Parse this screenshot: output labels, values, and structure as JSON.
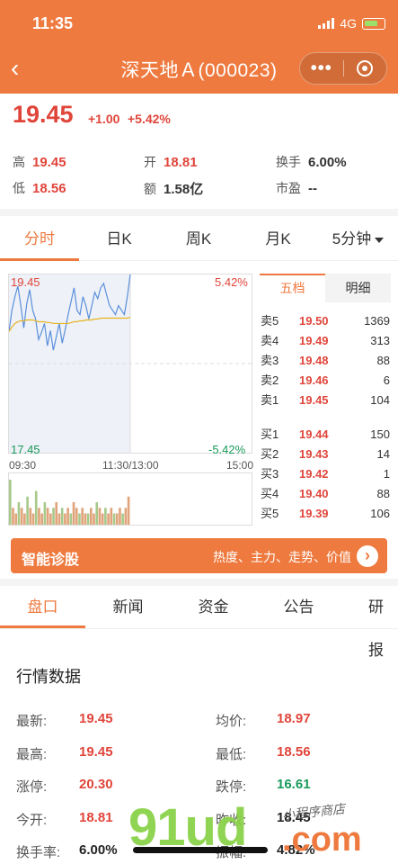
{
  "status": {
    "time": "11:35",
    "network": "4G"
  },
  "header": {
    "back_icon": "chevron-left-icon",
    "title": "深天地Ａ(000023)",
    "more_icon": "more-dots-icon",
    "close_icon": "target-ring-icon"
  },
  "quote": {
    "price": "19.45",
    "change": "+1.00",
    "change_pct": "+5.42%"
  },
  "summary": [
    {
      "k": "高",
      "v": "19.45",
      "color": "#e0453a"
    },
    {
      "k": "开",
      "v": "18.81",
      "color": "#e0453a"
    },
    {
      "k": "换手",
      "v": "6.00%",
      "color": "#333333"
    },
    {
      "k": "低",
      "v": "18.56",
      "color": "#e0453a"
    },
    {
      "k": "额",
      "v": "1.58亿",
      "color": "#333333"
    },
    {
      "k": "市盈",
      "v": "--",
      "color": "#333333"
    }
  ],
  "chart_tabs": [
    "分时",
    "日K",
    "周K",
    "月K",
    "5分钟"
  ],
  "chart_data": {
    "type": "line",
    "title": "",
    "ylim": [
      17.45,
      19.45
    ],
    "y_labels": {
      "top": "19.45",
      "bottom": "17.45",
      "top_pct": "5.42%",
      "bottom_pct": "-5.42%"
    },
    "time_labels": [
      "09:30",
      "11:30/13:00",
      "15:00"
    ],
    "series": [
      {
        "values": [
          18.81,
          19.05,
          19.2,
          19.32,
          19.1,
          18.85,
          19.12,
          19.28,
          19.05,
          18.95,
          18.72,
          18.8,
          18.9,
          18.65,
          18.82,
          18.6,
          18.75,
          18.9,
          18.68,
          18.83,
          19.0,
          19.15,
          19.3,
          19.05,
          19.0,
          19.2,
          19.1,
          18.95,
          19.1,
          19.25,
          19.18,
          19.3,
          19.35,
          19.22,
          19.1,
          19.05,
          19.0,
          19.1,
          19.05,
          19.0,
          19.2,
          19.45
        ]
      },
      {
        "values": [
          18.81,
          18.86,
          18.9,
          18.92,
          18.93,
          18.93,
          18.94,
          18.94,
          18.94,
          18.93,
          18.92,
          18.92,
          18.92,
          18.91,
          18.91,
          18.9,
          18.9,
          18.9,
          18.9,
          18.9,
          18.9,
          18.91,
          18.92,
          18.92,
          18.93,
          18.93,
          18.94,
          18.94,
          18.94,
          18.95,
          18.95,
          18.96,
          18.96,
          18.96,
          18.96,
          18.96,
          18.96,
          18.96,
          18.96,
          18.96,
          18.96,
          18.97
        ]
      }
    ],
    "volume": [
      8,
      3,
      2,
      4,
      3,
      2,
      5,
      3,
      2,
      6,
      3,
      2,
      4,
      3,
      2,
      3,
      4,
      2,
      3,
      2,
      3,
      2,
      4,
      3,
      2,
      3,
      2,
      2,
      3,
      2,
      4,
      3,
      2,
      3,
      2,
      3,
      2,
      2,
      3,
      2,
      3,
      5
    ]
  },
  "orderbook": {
    "tabs": [
      "五档",
      "明细"
    ],
    "sell": [
      {
        "n": "卖5",
        "p": "19.50",
        "q": "1369"
      },
      {
        "n": "卖4",
        "p": "19.49",
        "q": "313"
      },
      {
        "n": "卖3",
        "p": "19.48",
        "q": "88"
      },
      {
        "n": "卖2",
        "p": "19.46",
        "q": "6"
      },
      {
        "n": "卖1",
        "p": "19.45",
        "q": "104"
      }
    ],
    "buy": [
      {
        "n": "买1",
        "p": "19.44",
        "q": "150"
      },
      {
        "n": "买2",
        "p": "19.43",
        "q": "14"
      },
      {
        "n": "买3",
        "p": "19.42",
        "q": "1"
      },
      {
        "n": "买4",
        "p": "19.40",
        "q": "88"
      },
      {
        "n": "买5",
        "p": "19.39",
        "q": "106"
      }
    ]
  },
  "diagnosis": {
    "title": "智能诊股",
    "subtitle": "热度、主力、走势、价值",
    "arrow": "›"
  },
  "info_tabs": [
    "盘口",
    "新闻",
    "资金",
    "公告",
    "研报"
  ],
  "market": {
    "title": "行情数据",
    "rows": [
      {
        "k": "最新:",
        "v": "19.45",
        "c": "#e0453a",
        "k2": "均价:",
        "v2": "18.97",
        "c2": "#e0453a"
      },
      {
        "k": "最高:",
        "v": "19.45",
        "c": "#e0453a",
        "k2": "最低:",
        "v2": "18.56",
        "c2": "#e0453a"
      },
      {
        "k": "涨停:",
        "v": "20.30",
        "c": "#e0453a",
        "k2": "跌停:",
        "v2": "16.61",
        "c2": "#1a9a5a"
      },
      {
        "k": "今开:",
        "v": "18.81",
        "c": "#e0453a",
        "k2": "昨收:",
        "v2": "18.45",
        "c2": "#222222"
      },
      {
        "k": "换手率:",
        "v": "6.00%",
        "c": "#222222",
        "k2": "振幅:",
        "v2": "4.82%",
        "c2": "#222222"
      }
    ]
  },
  "watermark": {
    "brand": "91ud",
    "suffix": ".com",
    "tag": "小程序商店"
  }
}
